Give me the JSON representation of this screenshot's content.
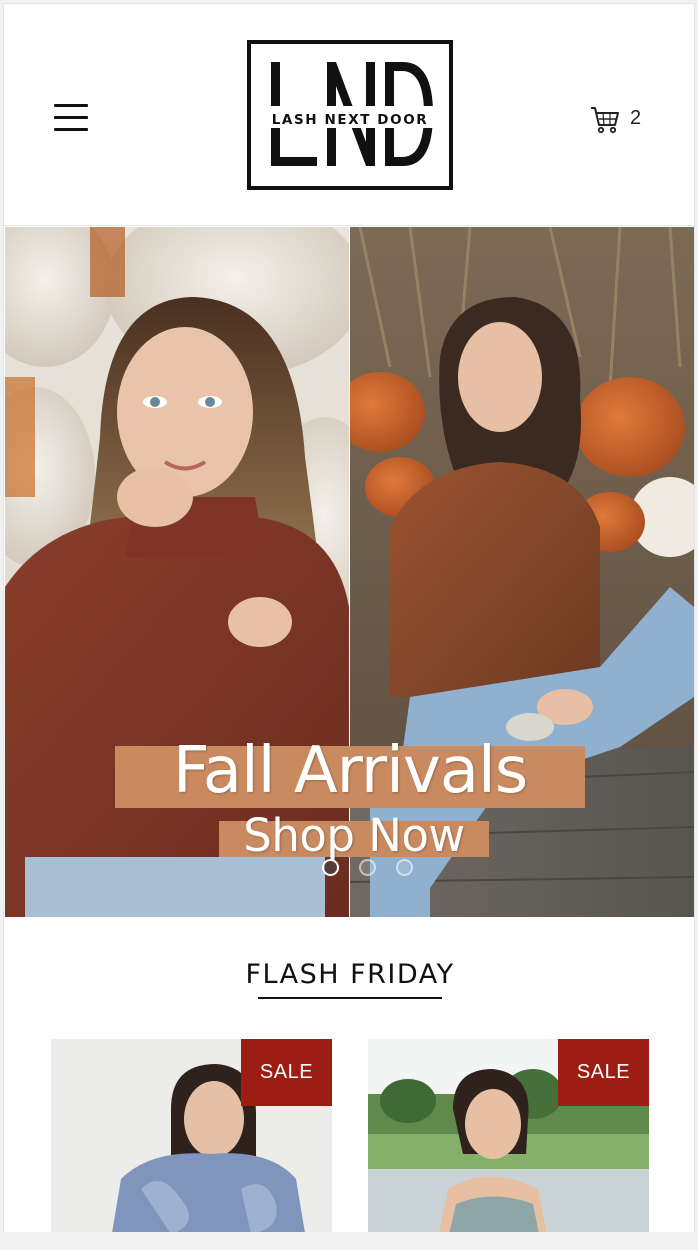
{
  "header": {
    "logo_letters": "LND",
    "logo_text": "LASH NEXT DOOR",
    "cart_count": "2"
  },
  "hero": {
    "title": "Fall Arrivals",
    "cta": "Shop Now",
    "slide_count": 3,
    "active_slide": 1
  },
  "section": {
    "title": "FLASH FRIDAY"
  },
  "products": [
    {
      "badge": "SALE"
    },
    {
      "badge": "SALE"
    }
  ],
  "colors": {
    "sale_badge": "#9c1d14",
    "hero_text_bg": "#c98a60",
    "text": "#111111"
  },
  "icons": [
    "menu-icon",
    "cart-icon"
  ]
}
